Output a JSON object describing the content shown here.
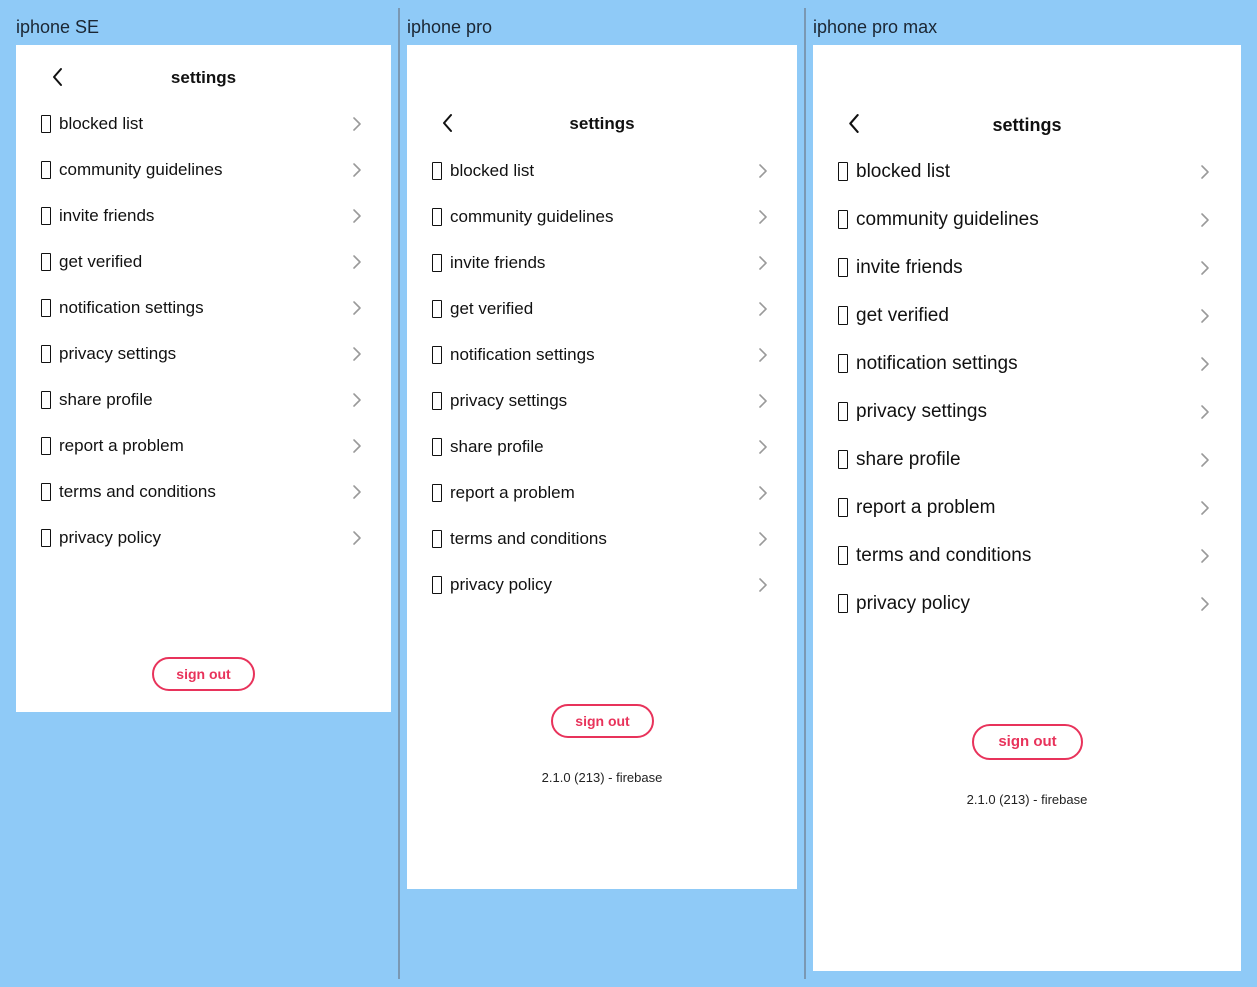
{
  "colors": {
    "canvas_background": "#8fcaf7",
    "frame_background": "#ffffff",
    "text": "#111111",
    "chevron": "#9a9a9a",
    "sign_out_accent": "#e8335b",
    "divider": "#7a98b3"
  },
  "icons": {
    "back": "chevron-left-icon",
    "row_glyph": "missing-glyph-icon",
    "row_arrow": "chevron-right-icon"
  },
  "columns": [
    {
      "label": "iphone SE",
      "screen": {
        "title": "settings",
        "menu_items": [
          {
            "label": "blocked list"
          },
          {
            "label": "community guidelines"
          },
          {
            "label": "invite friends"
          },
          {
            "label": "get verified"
          },
          {
            "label": "notification settings"
          },
          {
            "label": "privacy settings"
          },
          {
            "label": "share profile"
          },
          {
            "label": "report a problem"
          },
          {
            "label": "terms and conditions"
          },
          {
            "label": "privacy policy"
          }
        ],
        "sign_out_label": "sign out"
      }
    },
    {
      "label": "iphone pro",
      "screen": {
        "title": "settings",
        "menu_items": [
          {
            "label": "blocked list"
          },
          {
            "label": "community guidelines"
          },
          {
            "label": "invite friends"
          },
          {
            "label": "get verified"
          },
          {
            "label": "notification settings"
          },
          {
            "label": "privacy settings"
          },
          {
            "label": "share profile"
          },
          {
            "label": "report a problem"
          },
          {
            "label": "terms and conditions"
          },
          {
            "label": "privacy policy"
          }
        ],
        "sign_out_label": "sign out",
        "version": "2.1.0 (213) - firebase"
      }
    },
    {
      "label": "iphone pro max",
      "screen": {
        "title": "settings",
        "menu_items": [
          {
            "label": "blocked list"
          },
          {
            "label": "community guidelines"
          },
          {
            "label": "invite friends"
          },
          {
            "label": "get verified"
          },
          {
            "label": "notification settings"
          },
          {
            "label": "privacy settings"
          },
          {
            "label": "share profile"
          },
          {
            "label": "report a problem"
          },
          {
            "label": "terms and conditions"
          },
          {
            "label": "privacy policy"
          }
        ],
        "sign_out_label": "sign out",
        "version": "2.1.0 (213) - firebase"
      }
    }
  ]
}
